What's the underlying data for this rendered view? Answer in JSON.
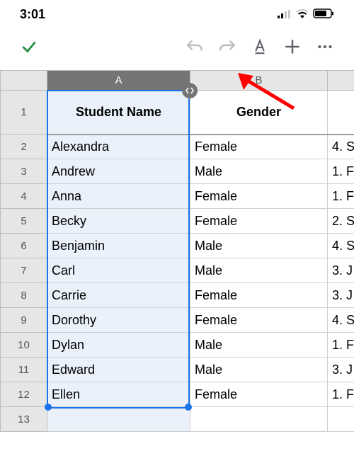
{
  "status": {
    "time": "3:01"
  },
  "columns": {
    "a": "A",
    "b": "B"
  },
  "rowNumbers": [
    "1",
    "2",
    "3",
    "4",
    "5",
    "6",
    "7",
    "8",
    "9",
    "10",
    "11",
    "12",
    "13"
  ],
  "header": {
    "a": "Student Name",
    "b": "Gender"
  },
  "rows": [
    {
      "a": "Alexandra",
      "b": "Female",
      "c": "4. S"
    },
    {
      "a": "Andrew",
      "b": "Male",
      "c": "1. F"
    },
    {
      "a": "Anna",
      "b": "Female",
      "c": "1. F"
    },
    {
      "a": "Becky",
      "b": "Female",
      "c": "2. S"
    },
    {
      "a": "Benjamin",
      "b": "Male",
      "c": "4. S"
    },
    {
      "a": "Carl",
      "b": "Male",
      "c": "3. J"
    },
    {
      "a": "Carrie",
      "b": "Female",
      "c": "3. J"
    },
    {
      "a": "Dorothy",
      "b": "Female",
      "c": "4. S"
    },
    {
      "a": "Dylan",
      "b": "Male",
      "c": "1. F"
    },
    {
      "a": "Edward",
      "b": "Male",
      "c": "3. J"
    },
    {
      "a": "Ellen",
      "b": "Female",
      "c": "1. F"
    }
  ]
}
